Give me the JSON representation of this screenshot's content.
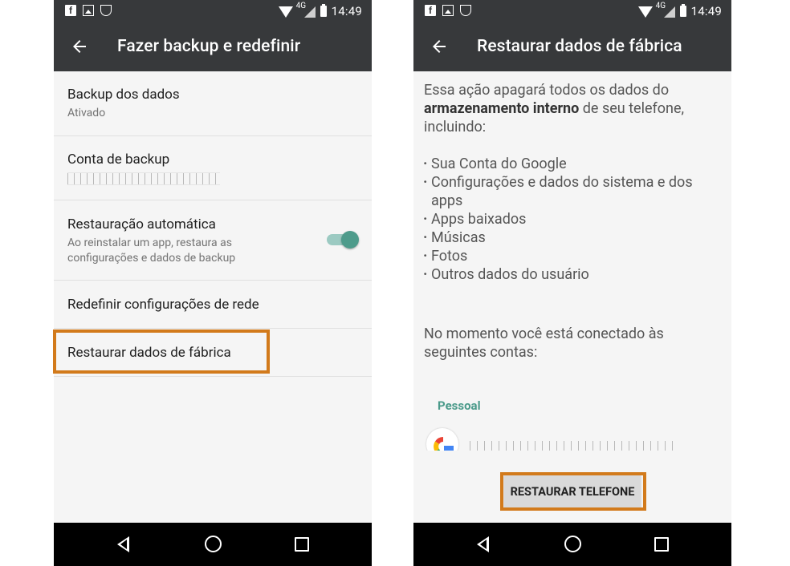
{
  "status_bar": {
    "time": "14:49",
    "network": "4G",
    "notification_icons": [
      "facebook-icon",
      "gallery-icon",
      "shield-icon"
    ]
  },
  "left_screen": {
    "title": "Fazer backup e redefinir",
    "items": [
      {
        "title": "Backup dos dados",
        "subtitle": "Ativado"
      },
      {
        "title": "Conta de backup"
      },
      {
        "title": "Restauração automática",
        "subtitle_line1": "Ao reinstalar um app, restaura as",
        "subtitle_line2": "configurações e dados de backup",
        "toggle_on": true
      },
      {
        "title": "Redefinir configurações de rede"
      },
      {
        "title": "Restaurar dados de fábrica"
      }
    ]
  },
  "right_screen": {
    "title": "Restaurar dados de fábrica",
    "intro_line1": "Essa ação apagará todos os dados do",
    "intro_bold": "armazenamento interno",
    "intro_line2_rest": " de seu telefone,",
    "intro_line3": "incluindo:",
    "bullets": [
      "Sua Conta do Google",
      "Configurações e dados do sistema e dos",
      "Apps baixados",
      "Músicas",
      "Fotos",
      "Outros dados do usuário"
    ],
    "bullet_continuation": "apps",
    "accounts_line1": "No momento você está conectado às",
    "accounts_line2": "seguintes contas:",
    "section_label": "Pessoal",
    "button_label": "RESTAURAR TELEFONE"
  },
  "colors": {
    "app_bar": "#37393b",
    "highlight": "#d27a1b",
    "accent": "#4e9b8b",
    "background": "#f5f5f5"
  }
}
